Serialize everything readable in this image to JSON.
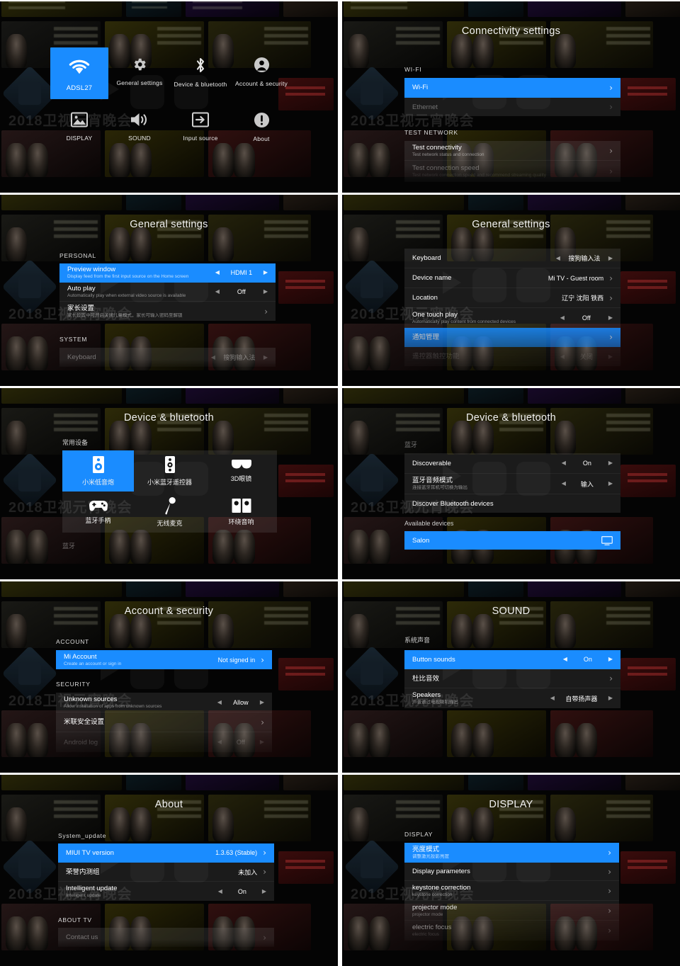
{
  "panels": {
    "home": {
      "tiles": [
        {
          "label": "ADSL27",
          "icon": "wifi-icon",
          "selected": true
        },
        {
          "label": "General settings",
          "icon": "gear-icon",
          "selected": false
        },
        {
          "label": "Device & bluetooth",
          "icon": "bluetooth-icon",
          "selected": false
        },
        {
          "label": "Account & security",
          "icon": "account-icon",
          "selected": false
        },
        {
          "label": "DISPLAY",
          "icon": "image-icon",
          "selected": false
        },
        {
          "label": "SOUND",
          "icon": "speaker-icon",
          "selected": false
        },
        {
          "label": "Input source",
          "icon": "input-arrow-icon",
          "selected": false
        },
        {
          "label": "About",
          "icon": "info-icon",
          "selected": false
        }
      ]
    },
    "connectivity": {
      "title": "Connectivity settings",
      "section_wifi": "WI-FI",
      "section_test": "TEST NETWORK",
      "wifi_rows": [
        {
          "title": "Wi-Fi",
          "sub": "",
          "value": "",
          "chev": "›",
          "state": "highlight"
        },
        {
          "title": "Ethernet",
          "sub": "",
          "value": "",
          "chev": "›",
          "state": "dim"
        }
      ],
      "test_rows": [
        {
          "title": "Test connectivity",
          "sub": "Test network status and connection",
          "value": "",
          "chev": "›",
          "state": "normal"
        },
        {
          "title": "Test connection speed",
          "sub": "Test network connection speed and recommend streaming quality",
          "value": "",
          "chev": "›",
          "state": "dim"
        }
      ]
    },
    "general_a": {
      "title": "General settings",
      "section_personal": "PERSONAL",
      "section_system": "SYSTEM",
      "personal_rows": [
        {
          "title": "Preview window",
          "sub": "Display feed from the first input source on the Home screen",
          "value": "HDMI 1",
          "type": "spinner",
          "state": "highlight"
        },
        {
          "title": "Auto play",
          "sub": "Automatically play when external video source is available",
          "value": "Off",
          "type": "spinner",
          "state": "normal"
        },
        {
          "title": "家长设置",
          "sub": "家长设置中可开启关闭儿童模式，家长可输入密码至解锁",
          "value": "",
          "type": "chevron",
          "state": "normal"
        }
      ],
      "system_rows": [
        {
          "title": "Keyboard",
          "sub": "",
          "value": "搜狗输入法",
          "type": "spinner",
          "state": "dim"
        }
      ]
    },
    "general_b": {
      "title": "General settings",
      "rows": [
        {
          "title": "Keyboard",
          "sub": "",
          "value": "搜狗输入法",
          "type": "spinner",
          "state": "normal"
        },
        {
          "title": "Device name",
          "sub": "",
          "value": "Mi TV - Guest room",
          "type": "chevron",
          "state": "normal"
        },
        {
          "title": "Location",
          "sub": "",
          "value": "辽宁 沈阳 铁西",
          "type": "chevron",
          "state": "normal"
        },
        {
          "title": "One touch play",
          "sub": "Automatically play content from connected devices",
          "value": "Off",
          "type": "spinner",
          "state": "normal"
        },
        {
          "title": "通知管理",
          "sub": "",
          "value": "",
          "type": "chevron",
          "state": "highlight"
        },
        {
          "title": "遥控器触控功能",
          "sub": "",
          "value": "关闭",
          "type": "spinner",
          "state": "dim"
        }
      ]
    },
    "bluetooth_a": {
      "title": "Device & bluetooth",
      "section_common": "常用设备",
      "section_bt": "蓝牙",
      "devices": [
        {
          "label": "小米低音炮",
          "icon": "subwoofer-icon",
          "selected": true
        },
        {
          "label": "小米蓝牙遥控器",
          "icon": "remote-icon",
          "selected": false
        },
        {
          "label": "3D眼镜",
          "icon": "glasses-icon",
          "selected": false
        },
        {
          "label": "蓝牙手柄",
          "icon": "gamepad-icon",
          "selected": false
        },
        {
          "label": "无线麦克",
          "icon": "microphone-icon",
          "selected": false
        },
        {
          "label": "环绕音响",
          "icon": "surround-speakers-icon",
          "selected": false
        }
      ]
    },
    "bluetooth_b": {
      "title": "Device & bluetooth",
      "section_bt": "蓝牙",
      "section_available": "Available devices",
      "rows": [
        {
          "title": "Discoverable",
          "sub": "",
          "value": "On",
          "type": "spinner",
          "state": "normal"
        },
        {
          "title": "蓝牙音频模式",
          "sub": "连接蓝牙耳机可切换为输出",
          "value": "输入",
          "type": "spinner",
          "state": "normal"
        },
        {
          "title": "Discover Bluetooth devices",
          "sub": "",
          "value": "",
          "type": "none",
          "state": "normal"
        }
      ],
      "available": [
        {
          "title": "Salon",
          "icon": "monitor-icon",
          "state": "highlight"
        }
      ]
    },
    "account": {
      "title": "Account & security",
      "section_account": "ACCOUNT",
      "section_security": "SECURITY",
      "account_rows": [
        {
          "title": "Mi Account",
          "sub": "Create an account or sign in",
          "value": "Not signed in",
          "type": "chevron",
          "state": "highlight"
        }
      ],
      "security_rows": [
        {
          "title": "Unknown sources",
          "sub": "Allow installation of apps from unknown sources",
          "value": "Allow",
          "type": "spinner",
          "state": "normal"
        },
        {
          "title": "米联安全设置",
          "sub": "",
          "value": "",
          "type": "chevron",
          "state": "normal"
        },
        {
          "title": "Android log",
          "sub": "",
          "value": "Off",
          "type": "spinner",
          "state": "dim"
        }
      ]
    },
    "sound": {
      "title": "SOUND",
      "section_system_sound": "系统声音",
      "rows": [
        {
          "title": "Button sounds",
          "sub": "",
          "value": "On",
          "type": "spinner",
          "state": "highlight"
        },
        {
          "title": "杜比音效",
          "sub": "",
          "value": "",
          "type": "chevron",
          "state": "normal"
        },
        {
          "title": "Speakers",
          "sub": "声音通过电视喇叭输出",
          "value": "自带扬声器",
          "type": "spinner",
          "state": "normal"
        }
      ]
    },
    "about": {
      "title": "About",
      "section_update": "System_update",
      "section_abouttv": "ABOUT TV",
      "update_rows": [
        {
          "title": "MIUI TV version",
          "sub": "",
          "value": "1.3.63  (Stable)",
          "type": "chevron",
          "state": "highlight"
        },
        {
          "title": "荣誉内测组",
          "sub": "",
          "value": "未加入",
          "type": "chevron",
          "state": "normal"
        },
        {
          "title": "Intelligent update",
          "sub": "Intelligent update",
          "value": "On",
          "type": "spinner",
          "state": "normal"
        }
      ],
      "abouttv_rows": [
        {
          "title": "Contact us",
          "sub": "",
          "value": "",
          "type": "chevron",
          "state": "dim"
        }
      ]
    },
    "display": {
      "title": "DISPLAY",
      "section_display": "DISPLAY",
      "rows": [
        {
          "title": "亮度模式",
          "sub": "调整激光投影亮度",
          "value": "",
          "type": "chevron",
          "state": "highlight"
        },
        {
          "title": "Display parameters",
          "sub": "",
          "value": "",
          "type": "chevron",
          "state": "normal"
        },
        {
          "title": "keystone correction",
          "sub": "keystone correction",
          "value": "",
          "type": "chevron",
          "state": "normal"
        },
        {
          "title": "projector mode",
          "sub": "projector mode",
          "value": "",
          "type": "chevron",
          "state": "normal"
        },
        {
          "title": "electric focus",
          "sub": "electric focus",
          "value": "",
          "type": "chevron",
          "state": "normal"
        }
      ]
    }
  },
  "colors": {
    "accent": "#1a8cff",
    "panel_bg": "#000000",
    "list_bg": "rgba(120,120,120,0.20)",
    "text": "#ffffff"
  },
  "glyphs": {
    "chevron_right": "›",
    "arrow_left": "◀",
    "arrow_right": "▶",
    "bg_big_text": "2018卫视元宵晚会"
  }
}
